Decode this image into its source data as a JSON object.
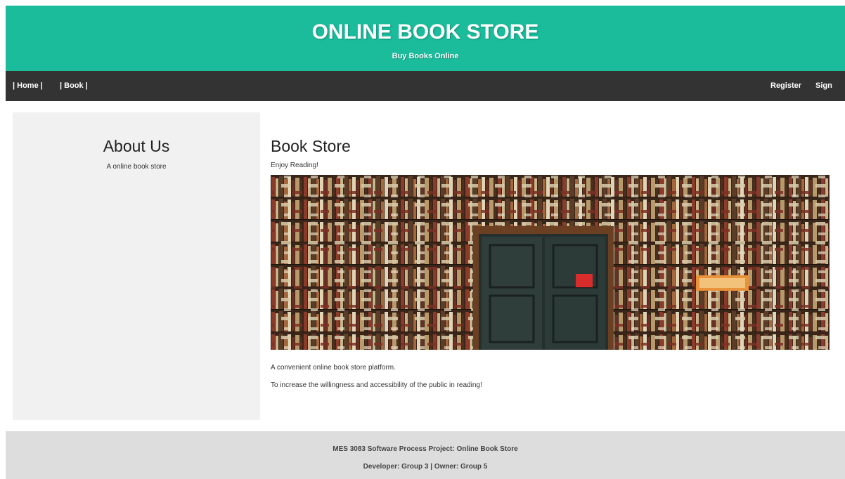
{
  "header": {
    "title": "ONLINE BOOK STORE",
    "subtitle": "Buy Books Online"
  },
  "nav": {
    "home": "| Home |",
    "book": "| Book |",
    "register": "Register",
    "signin": "Sign in"
  },
  "side": {
    "heading": "About Us",
    "text": "A online book store"
  },
  "main": {
    "heading": "Book Store",
    "subheading": "Enjoy Reading!",
    "para1": "A convenient online book store platform.",
    "para2": "To increase the willingness and accessibility of the public in reading!"
  },
  "footer": {
    "line1": "MES 3083 Software Process Project: Online Book Store",
    "line2": "Developer: Group 3 | Owner: Group 5"
  },
  "colors": {
    "header_bg": "#1abc9c",
    "nav_bg": "#333333",
    "side_bg": "#f1f1f1",
    "footer_bg": "#dddddd"
  }
}
